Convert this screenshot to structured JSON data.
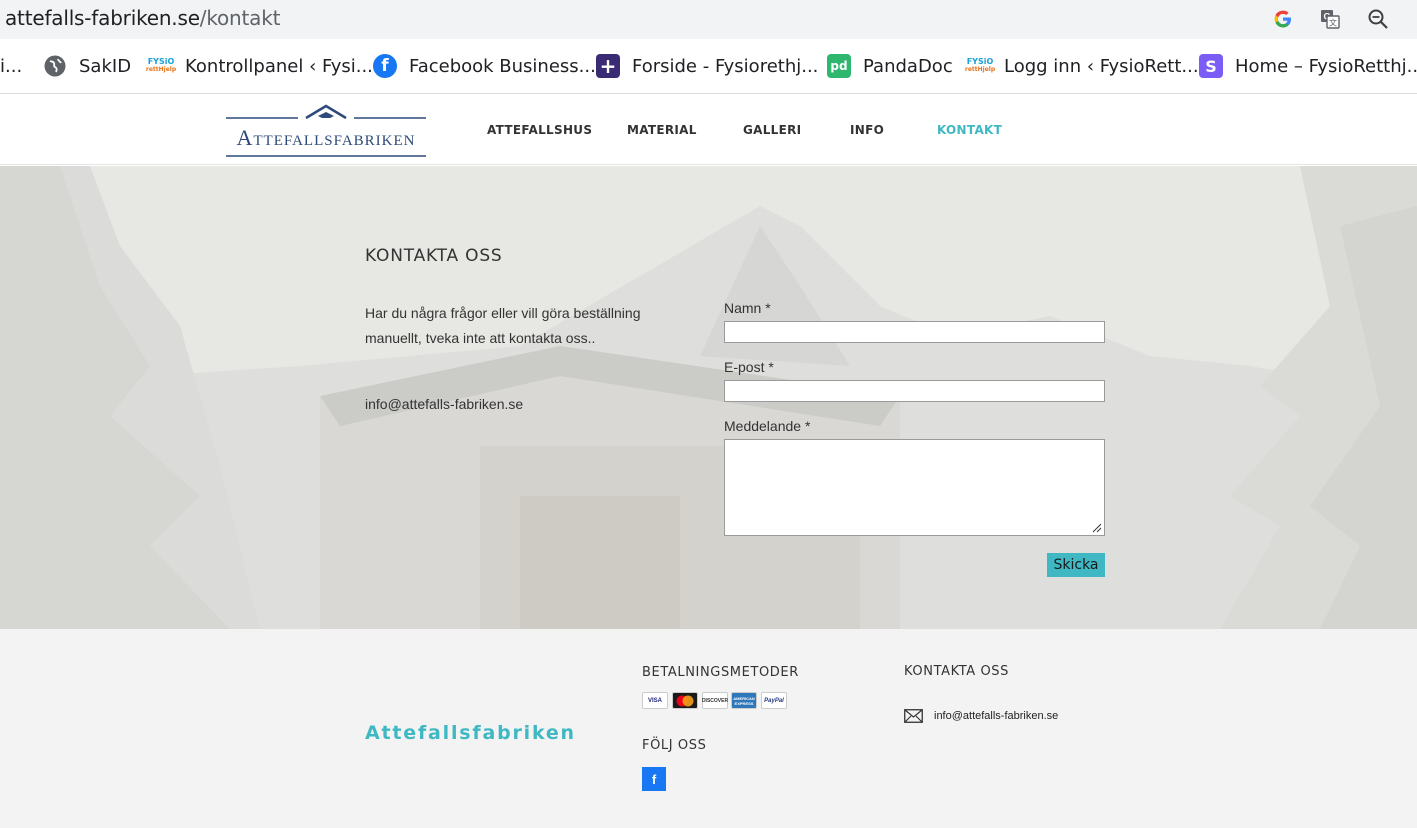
{
  "browser": {
    "url_domain": "attefalls-fabriken.se",
    "url_path": "/kontakt",
    "bookmarks": [
      {
        "label": "i..."
      },
      {
        "label": "SakID"
      },
      {
        "label": "Kontrollpanel ‹ Fysi..."
      },
      {
        "label": "Facebook Business..."
      },
      {
        "label": "Forside - Fysiorethj..."
      },
      {
        "label": "PandaDoc"
      },
      {
        "label": "Logg inn ‹ FysioRett..."
      },
      {
        "label": "Home – FysioRetthj..."
      }
    ]
  },
  "site": {
    "logo_text": "Attefallsfabriken",
    "nav": [
      {
        "label": "ATTEFALLSHUS"
      },
      {
        "label": "MATERIAL"
      },
      {
        "label": "GALLERI"
      },
      {
        "label": "INFO"
      },
      {
        "label": "KONTAKT"
      }
    ],
    "accent_color": "#3fb8c4"
  },
  "contact": {
    "title": "KONTAKTA OSS",
    "text": "Har du några frågor eller vill göra beställning manuellt, tveka inte att kontakta oss..",
    "email": "info@attefalls-fabriken.se",
    "form": {
      "name_label": "Namn *",
      "email_label": "E-post *",
      "message_label": "Meddelande *",
      "submit_label": "Skicka"
    }
  },
  "footer": {
    "brand": "Attefallsfabriken",
    "payment_heading": "BETALNINGSMETODER",
    "payment_methods": [
      "VISA",
      "MasterCard",
      "DISCOVER",
      "AMERICAN EXPRESS",
      "PayPal"
    ],
    "follow_heading": "FÖLJ OSS",
    "facebook_label": "f",
    "contact_heading": "KONTAKTA OSS",
    "contact_email": "info@attefalls-fabriken.se"
  }
}
